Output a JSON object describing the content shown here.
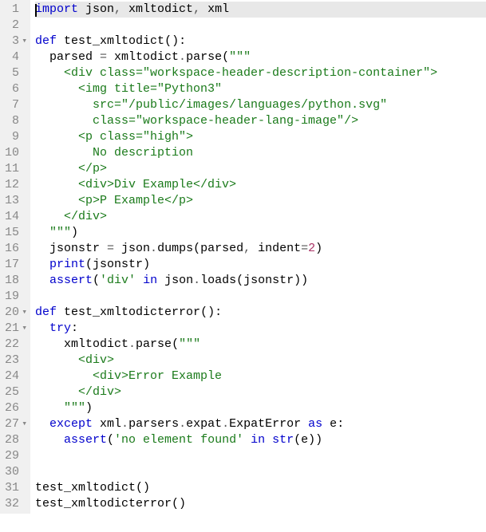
{
  "editor": {
    "active_line": 1,
    "lines": [
      {
        "n": 1,
        "fold": null,
        "tokens": [
          [
            "cursor",
            ""
          ],
          [
            "kw",
            "import"
          ],
          [
            "id",
            " json"
          ],
          [
            "op",
            ","
          ],
          [
            "id",
            " xmltodict"
          ],
          [
            "op",
            ","
          ],
          [
            "id",
            " xml"
          ]
        ]
      },
      {
        "n": 2,
        "fold": null,
        "tokens": []
      },
      {
        "n": 3,
        "fold": "▾",
        "tokens": [
          [
            "kw",
            "def"
          ],
          [
            "id",
            " "
          ],
          [
            "fn",
            "test_xmltodict"
          ],
          [
            "paren",
            "():"
          ]
        ]
      },
      {
        "n": 4,
        "fold": null,
        "tokens": [
          [
            "id",
            "  parsed "
          ],
          [
            "op",
            "="
          ],
          [
            "id",
            " xmltodict"
          ],
          [
            "op",
            "."
          ],
          [
            "id",
            "parse"
          ],
          [
            "paren",
            "("
          ],
          [
            "str",
            "\"\"\""
          ]
        ]
      },
      {
        "n": 5,
        "fold": null,
        "tokens": [
          [
            "str",
            "    <div class=\"workspace-header-description-container\">"
          ]
        ]
      },
      {
        "n": 6,
        "fold": null,
        "tokens": [
          [
            "str",
            "      <img title=\"Python3\""
          ]
        ]
      },
      {
        "n": 7,
        "fold": null,
        "tokens": [
          [
            "str",
            "        src=\"/public/images/languages/python.svg\""
          ]
        ]
      },
      {
        "n": 8,
        "fold": null,
        "tokens": [
          [
            "str",
            "        class=\"workspace-header-lang-image\"/>"
          ]
        ]
      },
      {
        "n": 9,
        "fold": null,
        "tokens": [
          [
            "str",
            "      <p class=\"high\">"
          ]
        ]
      },
      {
        "n": 10,
        "fold": null,
        "tokens": [
          [
            "str",
            "        No description"
          ]
        ]
      },
      {
        "n": 11,
        "fold": null,
        "tokens": [
          [
            "str",
            "      </p>"
          ]
        ]
      },
      {
        "n": 12,
        "fold": null,
        "tokens": [
          [
            "str",
            "      <div>Div Example</div>"
          ]
        ]
      },
      {
        "n": 13,
        "fold": null,
        "tokens": [
          [
            "str",
            "      <p>P Example</p>"
          ]
        ]
      },
      {
        "n": 14,
        "fold": null,
        "tokens": [
          [
            "str",
            "    </div>"
          ]
        ]
      },
      {
        "n": 15,
        "fold": null,
        "tokens": [
          [
            "str",
            "  \"\"\""
          ],
          [
            "paren",
            ")"
          ]
        ]
      },
      {
        "n": 16,
        "fold": null,
        "tokens": [
          [
            "id",
            "  jsonstr "
          ],
          [
            "op",
            "="
          ],
          [
            "id",
            " json"
          ],
          [
            "op",
            "."
          ],
          [
            "id",
            "dumps"
          ],
          [
            "paren",
            "("
          ],
          [
            "id",
            "parsed"
          ],
          [
            "op",
            ","
          ],
          [
            "id",
            " indent"
          ],
          [
            "op",
            "="
          ],
          [
            "num",
            "2"
          ],
          [
            "paren",
            ")"
          ]
        ]
      },
      {
        "n": 17,
        "fold": null,
        "tokens": [
          [
            "id",
            "  "
          ],
          [
            "builtin",
            "print"
          ],
          [
            "paren",
            "("
          ],
          [
            "id",
            "jsonstr"
          ],
          [
            "paren",
            ")"
          ]
        ]
      },
      {
        "n": 18,
        "fold": null,
        "tokens": [
          [
            "id",
            "  "
          ],
          [
            "builtin",
            "assert"
          ],
          [
            "paren",
            "("
          ],
          [
            "str",
            "'div'"
          ],
          [
            "id",
            " "
          ],
          [
            "kw",
            "in"
          ],
          [
            "id",
            " json"
          ],
          [
            "op",
            "."
          ],
          [
            "id",
            "loads"
          ],
          [
            "paren",
            "("
          ],
          [
            "id",
            "jsonstr"
          ],
          [
            "paren",
            "))"
          ]
        ]
      },
      {
        "n": 19,
        "fold": null,
        "tokens": []
      },
      {
        "n": 20,
        "fold": "▾",
        "tokens": [
          [
            "kw",
            "def"
          ],
          [
            "id",
            " "
          ],
          [
            "fn",
            "test_xmltodicterror"
          ],
          [
            "paren",
            "():"
          ]
        ]
      },
      {
        "n": 21,
        "fold": "▾",
        "tokens": [
          [
            "id",
            "  "
          ],
          [
            "kw",
            "try"
          ],
          [
            "paren",
            ":"
          ]
        ]
      },
      {
        "n": 22,
        "fold": null,
        "tokens": [
          [
            "id",
            "    xmltodict"
          ],
          [
            "op",
            "."
          ],
          [
            "id",
            "parse"
          ],
          [
            "paren",
            "("
          ],
          [
            "str",
            "\"\"\""
          ]
        ]
      },
      {
        "n": 23,
        "fold": null,
        "tokens": [
          [
            "str",
            "      <div>"
          ]
        ]
      },
      {
        "n": 24,
        "fold": null,
        "tokens": [
          [
            "str",
            "        <div>Error Example"
          ]
        ]
      },
      {
        "n": 25,
        "fold": null,
        "tokens": [
          [
            "str",
            "      </div>"
          ]
        ]
      },
      {
        "n": 26,
        "fold": null,
        "tokens": [
          [
            "str",
            "    \"\"\""
          ],
          [
            "paren",
            ")"
          ]
        ]
      },
      {
        "n": 27,
        "fold": "▾",
        "tokens": [
          [
            "id",
            "  "
          ],
          [
            "kw",
            "except"
          ],
          [
            "id",
            " xml"
          ],
          [
            "op",
            "."
          ],
          [
            "id",
            "parsers"
          ],
          [
            "op",
            "."
          ],
          [
            "id",
            "expat"
          ],
          [
            "op",
            "."
          ],
          [
            "id",
            "ExpatError"
          ],
          [
            "id",
            " "
          ],
          [
            "kw",
            "as"
          ],
          [
            "id",
            " e"
          ],
          [
            "paren",
            ":"
          ]
        ]
      },
      {
        "n": 28,
        "fold": null,
        "tokens": [
          [
            "id",
            "    "
          ],
          [
            "builtin",
            "assert"
          ],
          [
            "paren",
            "("
          ],
          [
            "str",
            "'no element found'"
          ],
          [
            "id",
            " "
          ],
          [
            "kw",
            "in"
          ],
          [
            "id",
            " "
          ],
          [
            "builtin",
            "str"
          ],
          [
            "paren",
            "("
          ],
          [
            "id",
            "e"
          ],
          [
            "paren",
            "))"
          ]
        ]
      },
      {
        "n": 29,
        "fold": null,
        "tokens": []
      },
      {
        "n": 30,
        "fold": null,
        "tokens": []
      },
      {
        "n": 31,
        "fold": null,
        "tokens": [
          [
            "id",
            "test_xmltodict"
          ],
          [
            "paren",
            "()"
          ]
        ]
      },
      {
        "n": 32,
        "fold": null,
        "tokens": [
          [
            "id",
            "test_xmltodicterror"
          ],
          [
            "paren",
            "()"
          ]
        ]
      }
    ]
  }
}
